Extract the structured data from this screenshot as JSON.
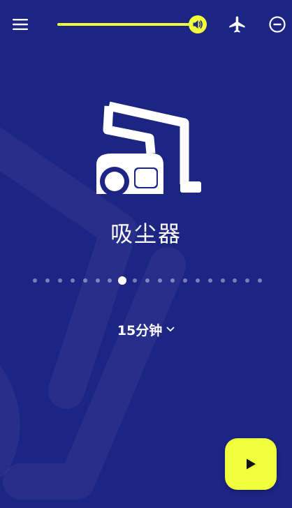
{
  "theme": {
    "background": "#1c2484",
    "accent": "#f0ff3c",
    "text": "#ffffff"
  },
  "topbar": {
    "menu_icon": "hamburger-menu-icon",
    "volume": {
      "level": 0.94,
      "icon": "speaker-icon"
    },
    "airplane_icon": "airplane-mode-icon",
    "dnd_icon": "do-not-disturb-icon"
  },
  "sound": {
    "icon": "vacuum-cleaner-icon",
    "title": "吸尘器"
  },
  "pager": {
    "count": 19,
    "active_index": 7
  },
  "timer": {
    "label": "15分钟",
    "icon": "chevron-down-icon"
  },
  "play_button": {
    "icon": "play-icon"
  }
}
